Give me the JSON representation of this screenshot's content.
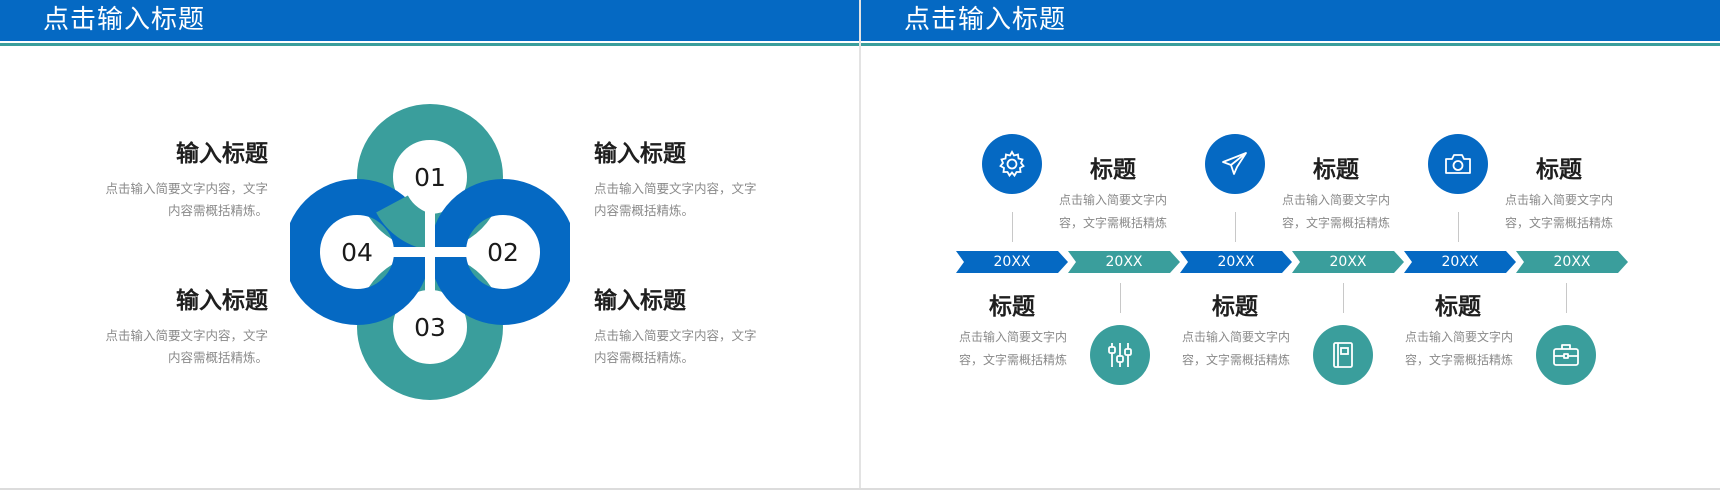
{
  "left_slide": {
    "header_title": "点击输入标题",
    "blocks": [
      {
        "title": "输入标题",
        "desc_line1": "点击输入简要文字内容，文字",
        "desc_line2": "内容需概括精炼。"
      },
      {
        "title": "输入标题",
        "desc_line1": "点击输入简要文字内容，文字",
        "desc_line2": "内容需概括精炼。"
      },
      {
        "title": "输入标题",
        "desc_line1": "点击输入简要文字内容，文字",
        "desc_line2": "内容需概括精炼。"
      },
      {
        "title": "输入标题",
        "desc_line1": "点击输入简要文字内容，文字",
        "desc_line2": "内容需概括精炼。"
      }
    ],
    "rings": [
      "01",
      "02",
      "03",
      "04"
    ]
  },
  "right_slide": {
    "header_title": "点击输入标题",
    "arrows": [
      "20XX",
      "20XX",
      "20XX",
      "20XX",
      "20XX",
      "20XX"
    ],
    "items": [
      {
        "icon": "gear-icon",
        "title": "标题",
        "desc_line1": "点击输入简要文字内",
        "desc_line2": "容，文字需概括精炼"
      },
      {
        "icon": "sliders-icon",
        "title": "标题",
        "desc_line1": "点击输入简要文字内",
        "desc_line2": "容，文字需概括精炼"
      },
      {
        "icon": "paper-plane-icon",
        "title": "标题",
        "desc_line1": "点击输入简要文字内",
        "desc_line2": "容，文字需概括精炼"
      },
      {
        "icon": "notebook-icon",
        "title": "标题",
        "desc_line1": "点击输入简要文字内",
        "desc_line2": "容，文字需概括精炼"
      },
      {
        "icon": "camera-icon",
        "title": "标题",
        "desc_line1": "点击输入简要文字内",
        "desc_line2": "容，文字需概括精炼"
      },
      {
        "icon": "briefcase-icon",
        "title": "标题",
        "desc_line1": "点击输入简要文字内",
        "desc_line2": "容，文字需概括精炼"
      }
    ]
  },
  "colors": {
    "blue": "#0569c3",
    "teal": "#3a9e9c"
  }
}
